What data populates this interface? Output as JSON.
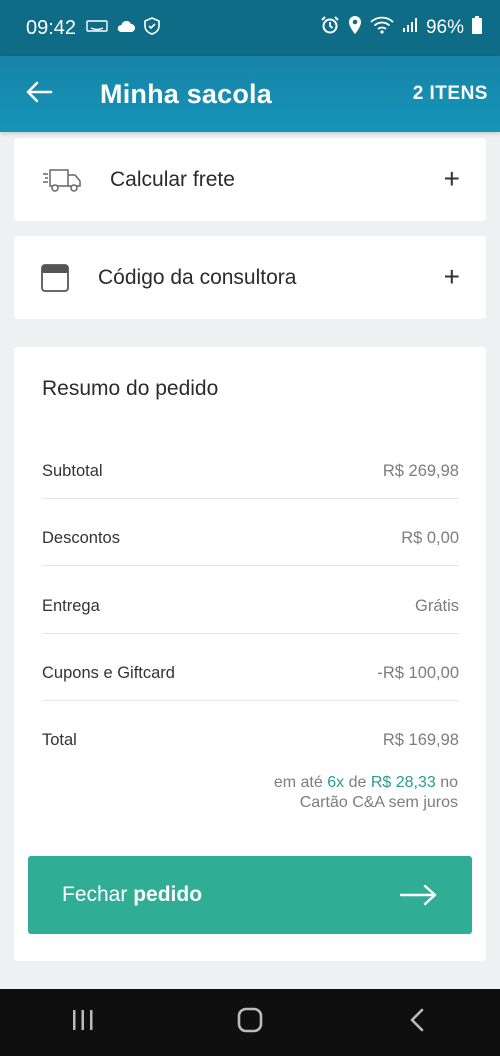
{
  "status_bar": {
    "time": "09:42",
    "battery": "96%",
    "icons": [
      "amazon-icon",
      "cloud-icon",
      "shield-icon",
      "alarm-icon",
      "location-icon",
      "wifi-icon",
      "signal-icon",
      "battery-icon"
    ]
  },
  "app_bar": {
    "title": "Minha sacola",
    "items_count": "2 ITENS"
  },
  "shipping": {
    "label": "Calcular frete",
    "icon": "truck-icon",
    "action": "+"
  },
  "consultant": {
    "label": "Código da consultora",
    "icon": "calendar-icon",
    "action": "+"
  },
  "summary": {
    "title": "Resumo do pedido",
    "rows": [
      {
        "label": "Subtotal",
        "value": "R$ 269,98"
      },
      {
        "label": "Descontos",
        "value": "R$ 0,00"
      },
      {
        "label": "Entrega",
        "value": "Grátis"
      },
      {
        "label": "Cupons e Giftcard",
        "value": "-R$ 100,00"
      },
      {
        "label": "Total",
        "value": "R$ 169,98"
      }
    ],
    "installments": {
      "prefix": "em até ",
      "count": "6x",
      "mid": " de ",
      "amount": "R$ 28,33",
      "suffix": " no",
      "line2": "Cartão C&A sem juros"
    }
  },
  "checkout": {
    "label_regular": "Fechar ",
    "label_bold": "pedido"
  },
  "colors": {
    "status_bar": "#0f6c87",
    "app_bar": "#1694ba",
    "accent": "#2fae95",
    "highlight": "#2a9d8f",
    "background": "#eef1f2"
  },
  "nav": {
    "icons": [
      "recent-apps-icon",
      "home-icon",
      "back-nav-icon"
    ]
  }
}
